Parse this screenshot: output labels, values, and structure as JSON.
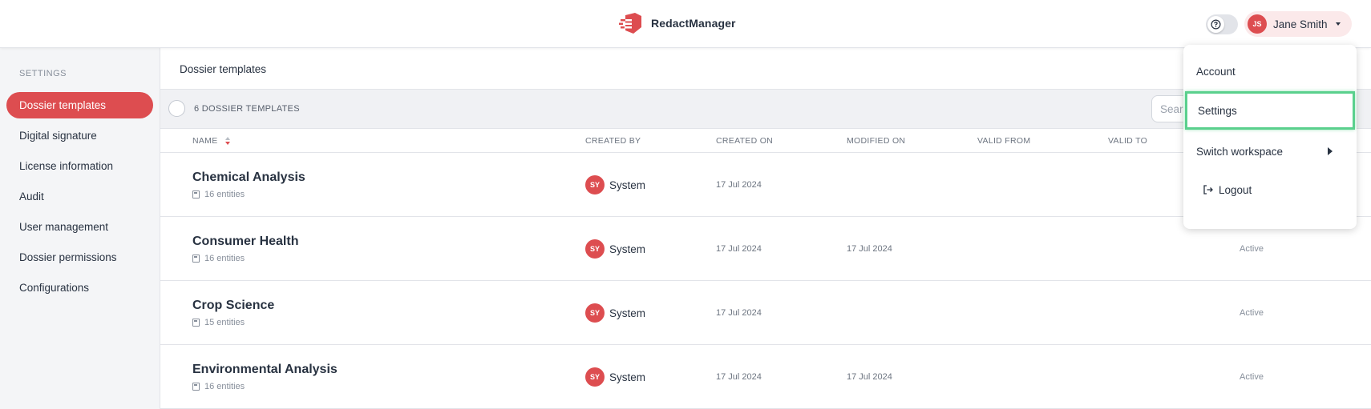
{
  "app": {
    "name": "RedactManager",
    "brand_color": "#dd4d50"
  },
  "header": {
    "user": {
      "initials": "JS",
      "name": "Jane Smith"
    }
  },
  "sidebar": {
    "heading": "SETTINGS",
    "items": [
      {
        "label": "Dossier templates",
        "active": true
      },
      {
        "label": "Digital signature",
        "active": false
      },
      {
        "label": "License information",
        "active": false
      },
      {
        "label": "Audit",
        "active": false
      },
      {
        "label": "User management",
        "active": false
      },
      {
        "label": "Dossier permissions",
        "active": false
      },
      {
        "label": "Configurations",
        "active": false
      }
    ]
  },
  "main": {
    "title": "Dossier templates",
    "count_label": "6 DOSSIER TEMPLATES",
    "search_placeholder": "Sear",
    "columns": [
      "NAME",
      "CREATED BY",
      "CREATED ON",
      "MODIFIED ON",
      "VALID FROM",
      "VALID TO"
    ],
    "rows": [
      {
        "name": "Chemical Analysis",
        "entities": "16 entities",
        "creator_initials": "SY",
        "creator": "System",
        "created_on": "17 Jul 2024",
        "modified_on": "",
        "status": ""
      },
      {
        "name": "Consumer Health",
        "entities": "16 entities",
        "creator_initials": "SY",
        "creator": "System",
        "created_on": "17 Jul 2024",
        "modified_on": "17 Jul 2024",
        "status": "Active"
      },
      {
        "name": "Crop Science",
        "entities": "15 entities",
        "creator_initials": "SY",
        "creator": "System",
        "created_on": "17 Jul 2024",
        "modified_on": "",
        "status": "Active"
      },
      {
        "name": "Environmental Analysis",
        "entities": "16 entities",
        "creator_initials": "SY",
        "creator": "System",
        "created_on": "17 Jul 2024",
        "modified_on": "17 Jul 2024",
        "status": "Active"
      }
    ]
  },
  "user_menu": {
    "account": "Account",
    "settings": "Settings",
    "switch_workspace": "Switch workspace",
    "logout": "Logout",
    "highlight_color": "#5ad08d"
  }
}
